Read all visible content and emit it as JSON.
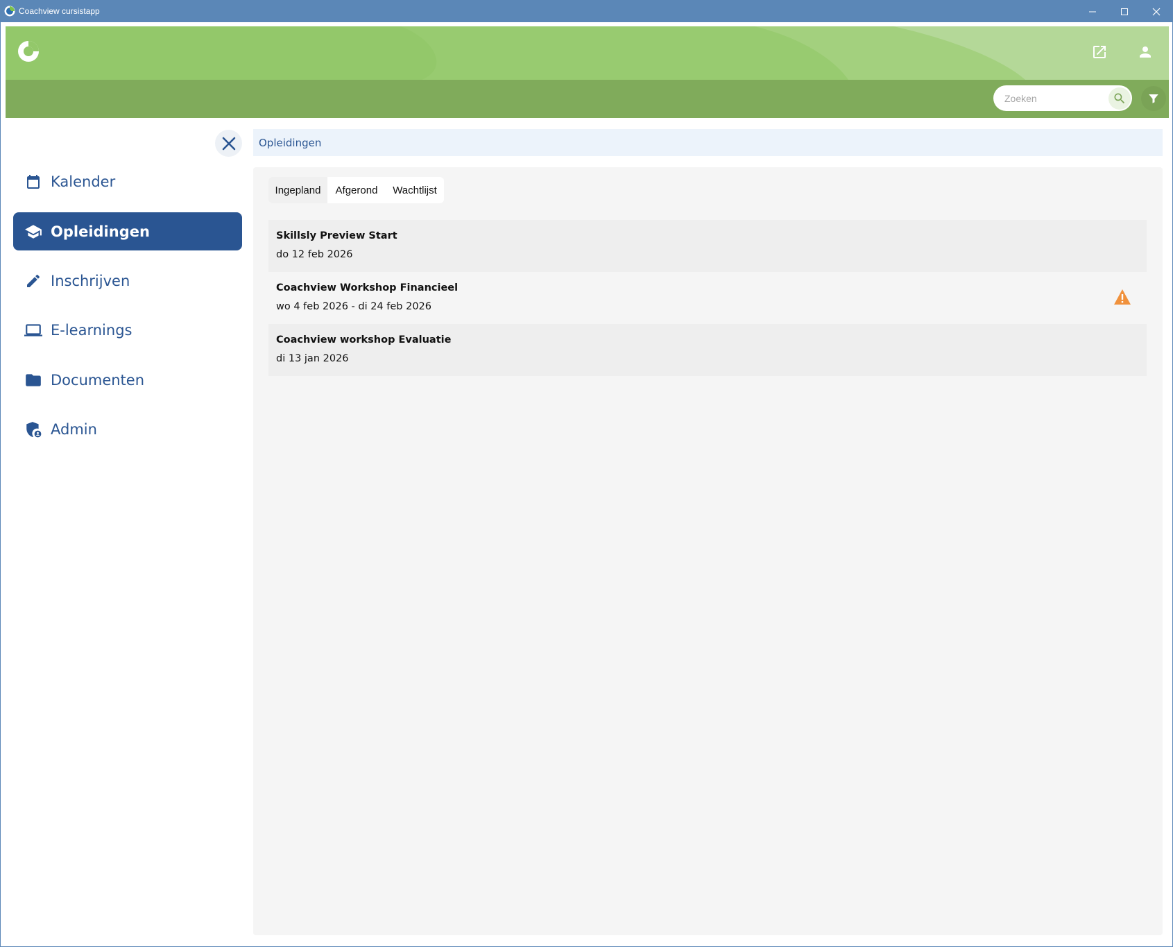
{
  "window": {
    "title": "Coachview cursistapp"
  },
  "header": {
    "search": {
      "placeholder": "Zoeken",
      "value": ""
    },
    "colors": {
      "header_green": "#93c86a",
      "subbar_green": "#80ab5b",
      "brand_blue": "#2a5592"
    }
  },
  "sidebar": {
    "items": [
      {
        "label": "Kalender",
        "icon": "calendar-icon",
        "active": false
      },
      {
        "label": "Opleidingen",
        "icon": "graduation-cap-icon",
        "active": true
      },
      {
        "label": "Inschrijven",
        "icon": "pencil-icon",
        "active": false
      },
      {
        "label": "E-learnings",
        "icon": "laptop-icon",
        "active": false
      },
      {
        "label": "Documenten",
        "icon": "folder-icon",
        "active": false
      },
      {
        "label": "Admin",
        "icon": "shield-user-icon",
        "active": false
      }
    ]
  },
  "breadcrumb": {
    "current": "Opleidingen"
  },
  "tabs": [
    {
      "label": "Ingepland",
      "active": true
    },
    {
      "label": "Afgerond",
      "active": false
    },
    {
      "label": "Wachtlijst",
      "active": false
    }
  ],
  "courses": [
    {
      "title": "Skillsly Preview Start",
      "date": "do 12 feb 2026",
      "warning": false
    },
    {
      "title": "Coachview Workshop Financieel",
      "date": "wo 4 feb 2026 - di 24 feb 2026",
      "warning": true,
      "warning_color": "#f0913c"
    },
    {
      "title": "Coachview workshop Evaluatie",
      "date": "di 13 jan 2026",
      "warning": false
    }
  ]
}
